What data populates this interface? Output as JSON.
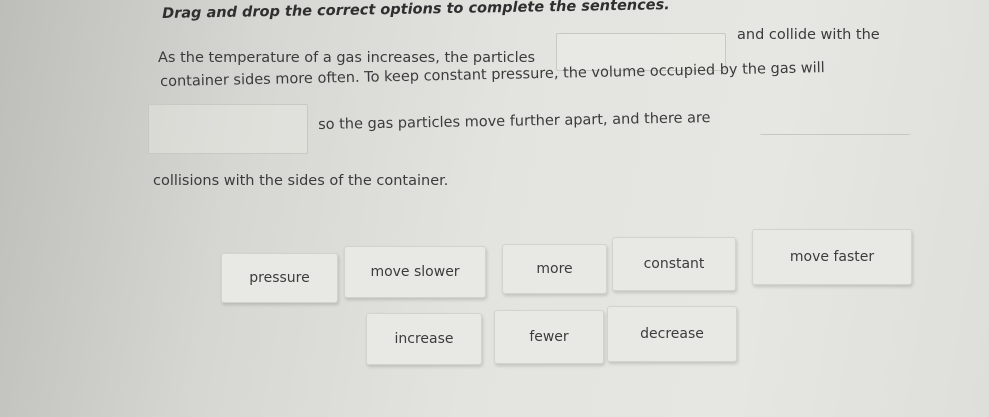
{
  "instructions": "Drag and drop the correct options to complete the sentences.",
  "sentence": {
    "line1_start": "As the temperature of a gas increases, the particles",
    "line1_end": "and collide with the",
    "line2": "container sides more often. To keep constant pressure, the volume occupied by the gas will",
    "line3": "so the gas particles move further apart, and there are",
    "line4": "collisions with the sides of the container."
  },
  "options": {
    "pressure": "pressure",
    "move_slower": "move slower",
    "more": "more",
    "constant": "constant",
    "move_faster": "move faster",
    "increase": "increase",
    "fewer": "fewer",
    "decrease": "decrease"
  }
}
